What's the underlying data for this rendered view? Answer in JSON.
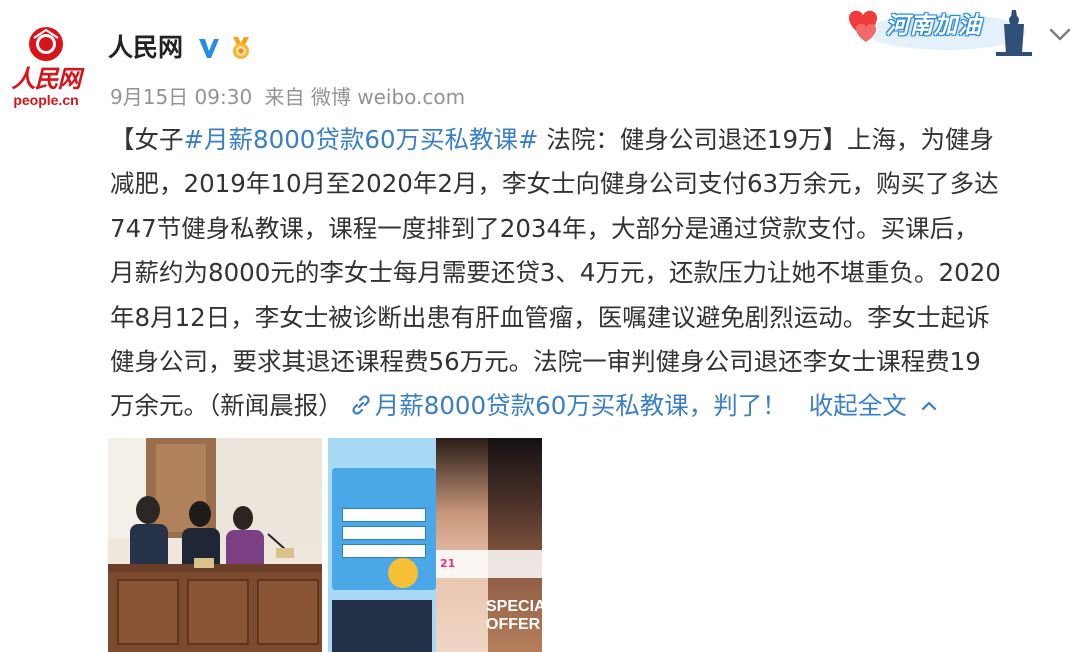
{
  "header": {
    "logo_text_cn": "人民网",
    "logo_text_en": "people.cn",
    "nickname": "人民网",
    "meta_date": "9月15日 09:30",
    "meta_source": "来自 微博 weibo.com",
    "badge_text": "河南加油"
  },
  "post": {
    "lines": [
      [
        "【女子",
        "#月薪8000贷款60万买私教课#",
        " 法院：健身公司退还19万】上海，为健身"
      ],
      [
        "减肥，2019年10月至2020年2月，李女士向健身公司支付63万余元，购买了多达"
      ],
      [
        "747节健身私教课，课程一度排到了2034年，大部分是通过贷款支付。买课后，"
      ],
      [
        "月薪约为8000元的李女士每月需要还贷3、4万元，还款压力让她不堪重负。2020"
      ],
      [
        "年8月12日，李女士被诊断出患有肝血管瘤，医嘱建议避免剧烈运动。李女士起诉"
      ],
      [
        "健身公司，要求其退还课程费56万元。法院一审判健身公司退还李女士课程费19"
      ],
      [
        "万余元。（新闻晨报）"
      ]
    ],
    "article_link": "月薪8000贷款60万买私教课，判了！",
    "collapse_label": "收起全文"
  },
  "images": {
    "ad_special": "SPECIAL OFFER",
    "ad_number": "21"
  },
  "colors": {
    "link": "#3a7fc6",
    "brand_red": "#d7141a",
    "meta_gray": "#939393"
  },
  "icons": [
    "people-logo-icon",
    "verified-v-icon",
    "medal-icon",
    "chevron-down-icon",
    "link-icon",
    "chevron-up-icon"
  ]
}
